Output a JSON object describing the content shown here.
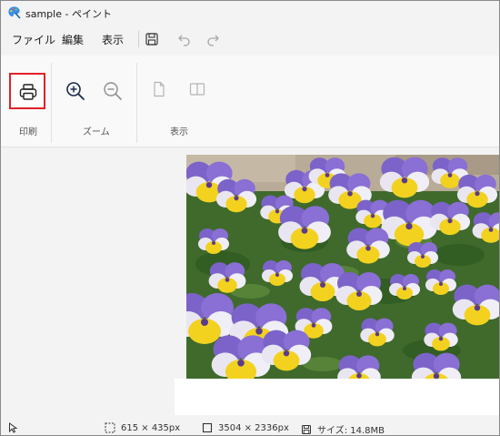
{
  "title_bar": {
    "title": "sample - ペイント",
    "app_icon": "paint-palette-icon"
  },
  "menu": {
    "file": "ファイル",
    "edit": "編集",
    "view": "表示",
    "save_icon": "save-icon",
    "undo_icon": "undo-icon",
    "redo_icon": "redo-icon"
  },
  "ribbon": {
    "print_group_label": "印刷",
    "zoom_group_label": "ズーム",
    "view_group_label": "表示",
    "print_icon": "printer-icon",
    "zoom_in_icon": "zoom-in-icon",
    "zoom_out_icon": "zoom-out-icon",
    "fit_page_icon": "page-icon",
    "two_page_icon": "two-page-icon"
  },
  "canvas": {
    "image_subject": "pansy-flowers-photo"
  },
  "status_bar": {
    "cursor_icon": "cursor-icon",
    "selection_icon": "selection-icon",
    "selection_size": "615 × 435px",
    "canvas_icon": "canvas-size-icon",
    "canvas_size": "3504 × 2336px",
    "file_icon": "file-save-icon",
    "file_size": "サイズ: 14.8MB"
  },
  "colors": {
    "accent_highlight": "#e0212a",
    "window_bg": "#f3f3f3"
  }
}
